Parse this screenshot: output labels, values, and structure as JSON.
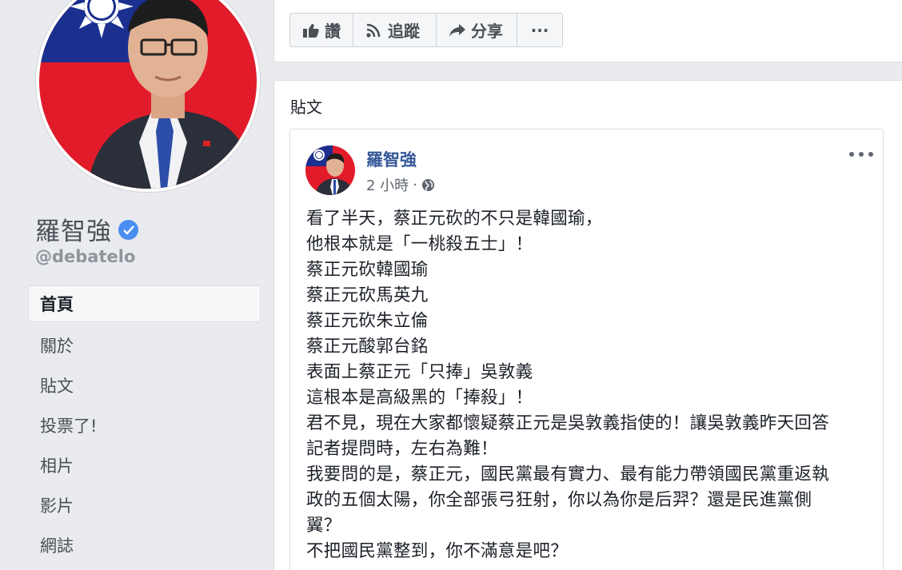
{
  "profile": {
    "name": "羅智強",
    "handle": "@debatelo",
    "verified": true
  },
  "nav": {
    "items": [
      {
        "label": "首頁",
        "active": true
      },
      {
        "label": "關於"
      },
      {
        "label": "貼文"
      },
      {
        "label": "投票了!"
      },
      {
        "label": "相片"
      },
      {
        "label": "影片"
      },
      {
        "label": "網誌"
      }
    ]
  },
  "actions": {
    "like_label": "讚",
    "follow_label": "追蹤",
    "share_label": "分享",
    "more_label": "···"
  },
  "posts_section": {
    "heading": "貼文"
  },
  "post": {
    "author": "羅智強",
    "time": "2 小時",
    "separator": "·",
    "privacy_icon": "globe-icon",
    "lines": [
      "看了半天，蔡正元砍的不只是韓國瑜，",
      "他根本就是「一桃殺五士」！",
      "蔡正元砍韓國瑜",
      "蔡正元砍馬英九",
      "蔡正元砍朱立倫",
      "蔡正元酸郭台銘",
      "表面上蔡正元「只捧」吳敦義",
      "這根本是高級黑的「捧殺」！",
      "君不見，現在大家都懷疑蔡正元是吳敦義指使的！讓吳敦義昨天回答",
      "記者提問時，左右為難！",
      "我要問的是，蔡正元，國民黨最有實力、最有能力帶領國民黨重返執",
      "政的五個太陽，你全部張弓狂射，你以為你是后羿？還是民進黨側",
      "翼？",
      "不把國民黨整到，你不滿意是吧？"
    ]
  },
  "colors": {
    "background": "#e9ebee",
    "link": "#365899",
    "verified": "#4a8ef0",
    "flag_red": "#e21b2a",
    "flag_blue": "#1b2f8f"
  }
}
